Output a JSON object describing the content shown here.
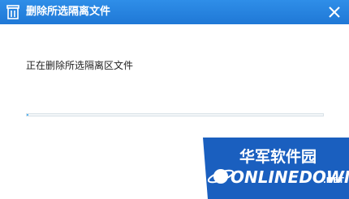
{
  "window": {
    "title": "删除所选隔离文件",
    "close_icon": "close-icon",
    "app_icon": "trash-icon"
  },
  "content": {
    "message": "正在删除所选隔离区文件",
    "progress_fraction": 0.005
  },
  "watermark": {
    "site_name_cn": "华军软件园",
    "site_name_en": "ONLINEDOWN",
    "suffix": ".NET"
  },
  "colors": {
    "titlebar": "#2383df",
    "progress_fill": "#59b6f2",
    "watermark_blue": "#1a5fbf"
  }
}
